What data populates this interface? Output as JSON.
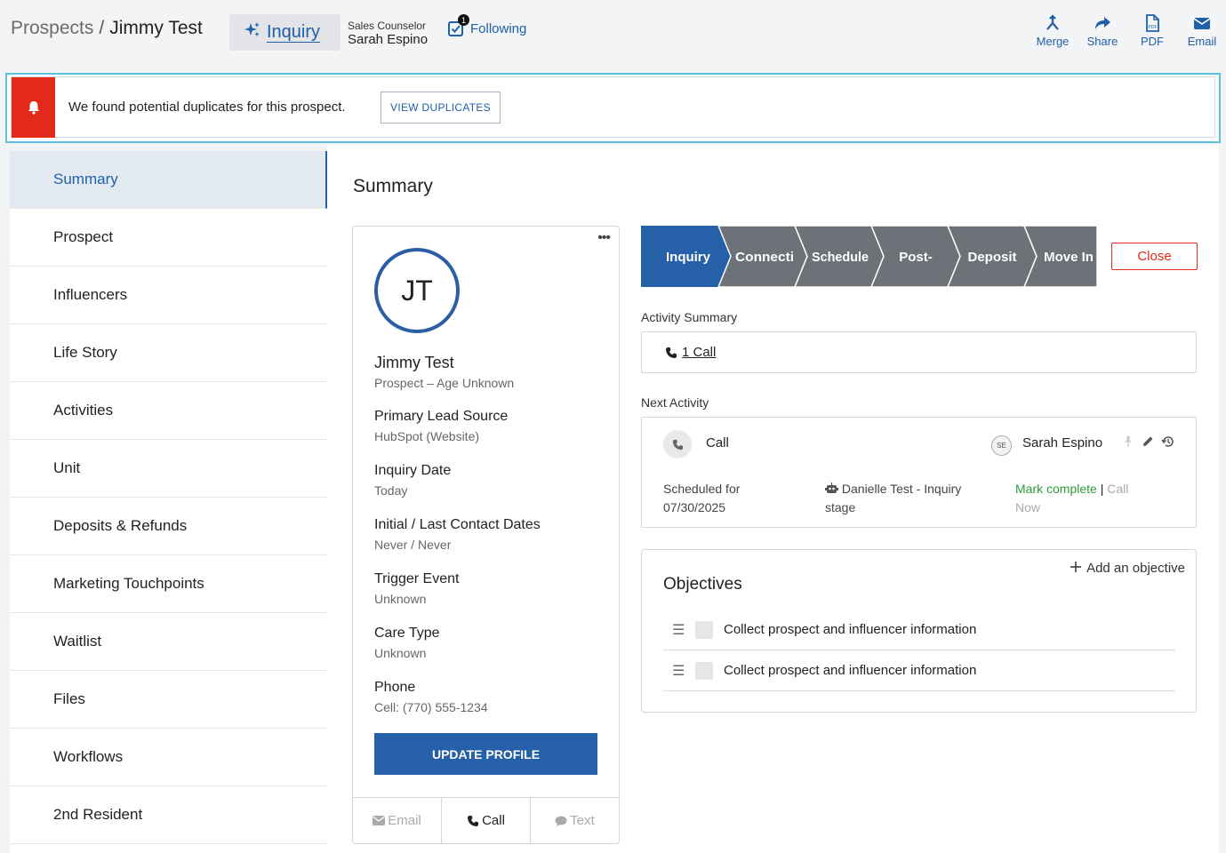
{
  "header": {
    "breadcrumb_root": "Prospects",
    "breadcrumb_sep": "/",
    "breadcrumb_current": "Jimmy Test",
    "stage_chip": "Inquiry",
    "counselor_label": "Sales Counselor",
    "counselor_name": "Sarah Espino",
    "following_label": "Following",
    "following_count": "1",
    "actions": [
      {
        "label": "Merge",
        "icon": "merge-icon"
      },
      {
        "label": "Share",
        "icon": "share-icon"
      },
      {
        "label": "PDF",
        "icon": "pdf-icon"
      },
      {
        "label": "Email",
        "icon": "email-icon"
      }
    ]
  },
  "alert": {
    "message": "We found potential duplicates for this prospect.",
    "button": "VIEW DUPLICATES"
  },
  "sidebar": {
    "items": [
      {
        "label": "Summary",
        "active": true
      },
      {
        "label": "Prospect"
      },
      {
        "label": "Influencers"
      },
      {
        "label": "Life Story"
      },
      {
        "label": "Activities"
      },
      {
        "label": "Unit"
      },
      {
        "label": "Deposits & Refunds"
      },
      {
        "label": "Marketing Touchpoints"
      },
      {
        "label": "Waitlist"
      },
      {
        "label": "Files"
      },
      {
        "label": "Workflows"
      },
      {
        "label": "2nd Resident"
      }
    ]
  },
  "main": {
    "title": "Summary",
    "profile": {
      "initials": "JT",
      "name": "Jimmy Test",
      "subtitle": "Prospect – Age Unknown",
      "fields": [
        {
          "label": "Primary Lead Source",
          "value": "HubSpot (Website)"
        },
        {
          "label": "Inquiry Date",
          "value": "Today"
        },
        {
          "label": "Initial / Last Contact Dates",
          "value": "Never / Never"
        },
        {
          "label": "Trigger Event",
          "value": "Unknown"
        },
        {
          "label": "Care Type",
          "value": "Unknown"
        },
        {
          "label": "Phone",
          "value": "Cell: (770) 555-1234"
        }
      ],
      "update_button": "UPDATE PROFILE",
      "contact": {
        "email": "Email",
        "call": "Call",
        "text": "Text"
      }
    },
    "stages": [
      "Inquiry",
      "Connecti",
      "Schedule",
      "Post-",
      "Deposit",
      "Move In"
    ],
    "active_stage": "Inquiry",
    "close_button": "Close",
    "activity_summary": {
      "label": "Activity Summary",
      "link": "1 Call"
    },
    "next_activity": {
      "label": "Next Activity",
      "type": "Call",
      "owner_initials": "SE",
      "owner": "Sarah Espino",
      "scheduled_line1": "Scheduled for",
      "scheduled_line2": "07/30/2025",
      "workflow_line1": "Danielle Test - Inquiry",
      "workflow_line2": "stage",
      "mark_complete": "Mark complete",
      "separator": "|",
      "call_now_1": "Call",
      "call_now_2": "Now"
    },
    "objectives": {
      "title": "Objectives",
      "add_label": "Add an objective",
      "items": [
        "Collect prospect and influencer information",
        "Collect prospect and influencer information"
      ]
    }
  },
  "colors": {
    "brand_blue": "#2560a8",
    "stage_gray": "#6d7278",
    "alert_red": "#e32a1a",
    "success_green": "#2e9b3a",
    "highlight_cyan": "#59c1de"
  }
}
